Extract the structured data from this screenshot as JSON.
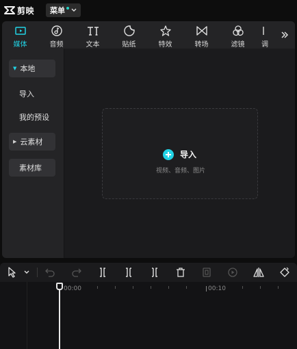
{
  "app": {
    "name": "剪映",
    "menu_label": "菜单"
  },
  "tabs": [
    {
      "label": "媒体",
      "icon": "media-icon",
      "active": true
    },
    {
      "label": "音频",
      "icon": "audio-icon"
    },
    {
      "label": "文本",
      "icon": "text-icon"
    },
    {
      "label": "贴纸",
      "icon": "sticker-icon"
    },
    {
      "label": "特效",
      "icon": "effects-icon"
    },
    {
      "label": "转场",
      "icon": "transition-icon"
    },
    {
      "label": "滤镜",
      "icon": "filter-icon"
    },
    {
      "label": "调",
      "icon": "adjust-icon"
    }
  ],
  "sidebar": {
    "items": [
      {
        "label": "本地",
        "expanded": true
      },
      {
        "label": "导入"
      },
      {
        "label": "我的预设"
      },
      {
        "label": "云素材"
      },
      {
        "label": "素材库"
      }
    ]
  },
  "dropzone": {
    "import_label": "导入",
    "hint": "视频、音频、图片"
  },
  "timeline": {
    "labels": [
      "00:00",
      "00:10"
    ]
  },
  "colors": {
    "accent": "#22d3e5",
    "background": "#0d0d0d",
    "panel": "#1b1b1d"
  }
}
